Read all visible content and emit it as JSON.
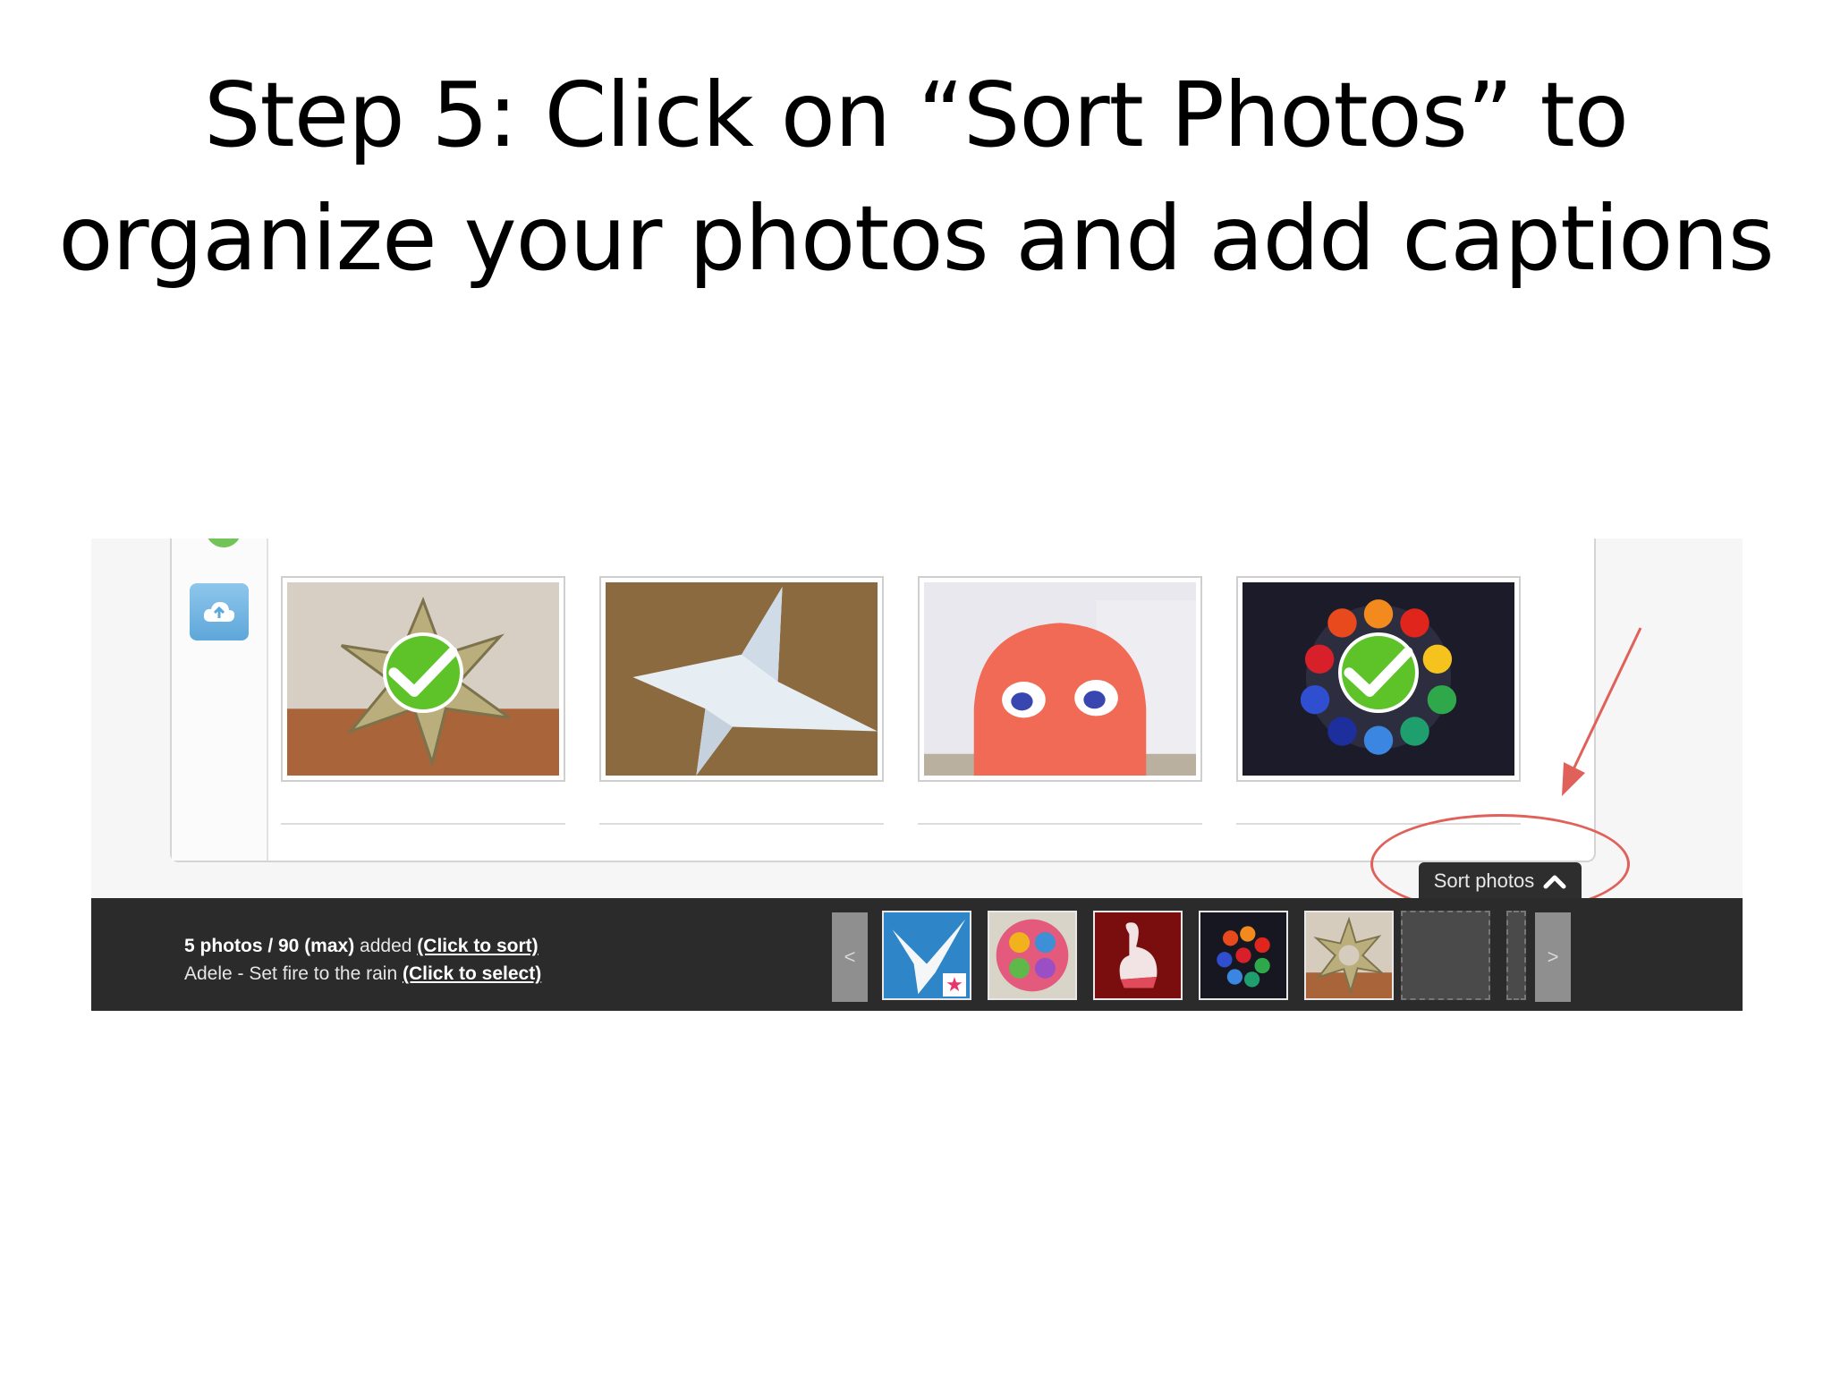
{
  "slide": {
    "title_line1": "Step 5: Click on “Sort Photos” to",
    "title_line2": "organize your photos and add captions"
  },
  "gallery": {
    "photos": [
      {
        "name": "money-star-origami",
        "selected": true
      },
      {
        "name": "paper-shuriken",
        "selected": false
      },
      {
        "name": "3d-origami-pacman-ghost",
        "selected": false
      },
      {
        "name": "rose-ball-origami",
        "selected": true
      }
    ]
  },
  "sidebar": {
    "upload_icon": "cloud-upload-icon"
  },
  "sort_tab": {
    "label": "Sort photos",
    "icon": "chevron-up-icon"
  },
  "bottom_bar": {
    "count_bold": "5 photos / 90 (max)",
    "count_rest": " added ",
    "sort_link": "(Click to sort)",
    "song": "Adele - Set fire to the rain ",
    "select_link": "(Click to select)",
    "prev": "<",
    "next": ">",
    "thumbnails": [
      "paper-crane",
      "flower-kusudama",
      "swan-origami",
      "rose-ball-origami",
      "money-star-origami"
    ],
    "star": "★"
  },
  "annotation": {
    "color": "#e0605a"
  },
  "colors": {
    "check_green": "#5dc329",
    "bar": "#2b2b2b",
    "upload_blue": "#6fb3e2"
  }
}
